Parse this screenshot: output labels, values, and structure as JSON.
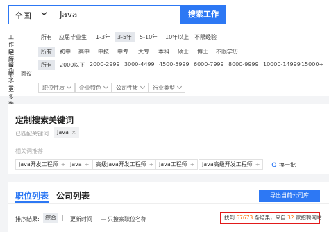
{
  "search": {
    "city": "全国",
    "keyword": "Java",
    "button": "搜索工作"
  },
  "filters": {
    "experience": {
      "label": "工作经验:",
      "options": [
        "所有",
        "应届毕业生",
        "1-3年",
        "3-5年",
        "5-10年",
        "10年以上",
        "不限经验"
      ],
      "selected": "3-5年"
    },
    "education": {
      "label": "学历要求:",
      "options": [
        "所有",
        "初中",
        "高中",
        "中技",
        "中专",
        "大专",
        "本科",
        "硕士",
        "博士",
        "不限学历"
      ],
      "selected": "所有"
    },
    "salary": {
      "label": "薪酬水平:",
      "options": [
        "所有",
        "2000以下",
        "2000-2999",
        "3000-4499",
        "4500-5999",
        "6000-7999",
        "8000-9999",
        "10000-14999",
        "15000+",
        "面议"
      ],
      "selected": "所有"
    },
    "more": {
      "label": "更多选项:",
      "dropdowns": [
        "职位性质",
        "企业特色",
        "公司性质",
        "行业类型"
      ]
    }
  },
  "custom_keywords": {
    "title": "定制搜索关键词",
    "matched_label": "已匹配关键词",
    "matched_tag": "Java",
    "related_label": "相关词推荐",
    "related": [
      "java开发工程师",
      "java",
      "高级java开发工程师",
      "java工程师",
      "java高级开发工程师"
    ],
    "refresh": "换一批"
  },
  "results": {
    "tab_positions": "职位列表",
    "tab_companies": "公司列表",
    "export_button": "导出当前公司库",
    "sort_label": "排序结果:",
    "sort_active": "综合",
    "sort_time": "更新时间",
    "checkbox_label": "只搜索职位名称",
    "summary_prefix": "找到 ",
    "summary_count": "67673",
    "summary_middle": " 条结果，来自 ",
    "summary_sites": "32",
    "summary_suffix": " 家招聘网站"
  },
  "colors": {
    "accent": "#2d78f4",
    "highlight_border": "#e11a1a",
    "count": "#ff6a00"
  }
}
